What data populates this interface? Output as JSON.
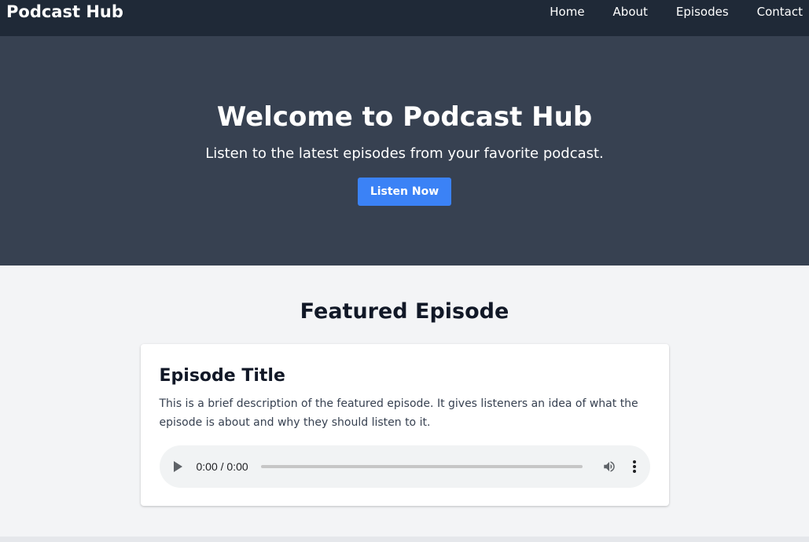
{
  "header": {
    "brand": "Podcast Hub",
    "nav": [
      "Home",
      "About",
      "Episodes",
      "Contact"
    ]
  },
  "hero": {
    "title": "Welcome to Podcast Hub",
    "subtitle": "Listen to the latest episodes from your favorite podcast.",
    "cta_label": "Listen Now"
  },
  "featured": {
    "heading": "Featured Episode",
    "episode_title": "Episode Title",
    "episode_description": "This is a brief description of the featured episode. It gives listeners an idea of what the episode is about and why they should listen to it.",
    "player": {
      "time": "0:00 / 0:00"
    }
  },
  "colors": {
    "header_bg": "#1f2937",
    "hero_bg": "#374151",
    "accent": "#3b82f6",
    "page_bg": "#f3f4f6"
  },
  "icons": [
    "play-icon",
    "volume-icon",
    "more-vert-icon"
  ]
}
